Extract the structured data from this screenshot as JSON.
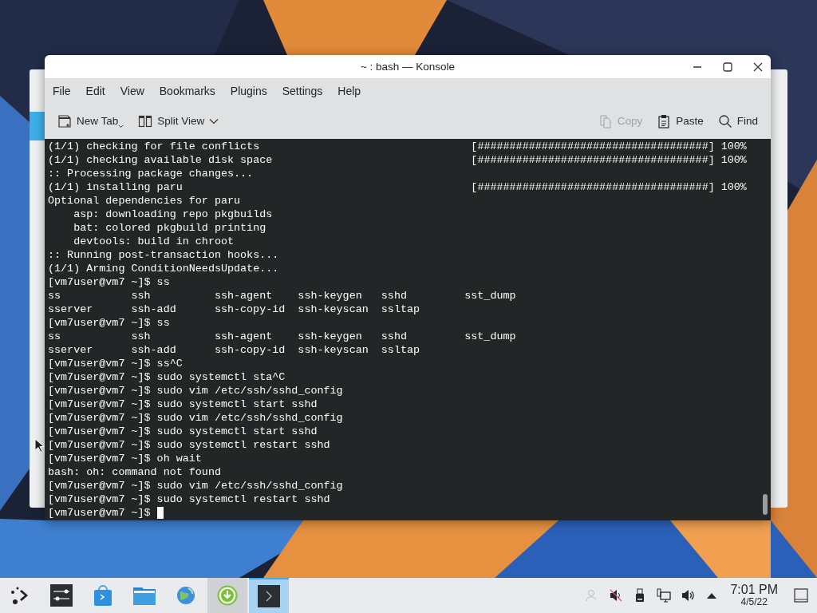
{
  "window": {
    "title": "~ : bash — Konsole"
  },
  "menu": [
    "File",
    "Edit",
    "View",
    "Bookmarks",
    "Plugins",
    "Settings",
    "Help"
  ],
  "toolbar": {
    "left": [
      {
        "kind": "new-tab",
        "label": "New Tab"
      },
      {
        "kind": "split-view",
        "label": "Split View"
      }
    ],
    "right": [
      {
        "kind": "copy",
        "label": "Copy",
        "disabled": true
      },
      {
        "kind": "paste",
        "label": "Paste",
        "disabled": false
      },
      {
        "kind": "find",
        "label": "Find",
        "disabled": false
      }
    ]
  },
  "terminal": {
    "lines": [
      {
        "kind": "text",
        "text": "(1/1) checking for file conflicts",
        "progress": "[####################################] 100%"
      },
      {
        "kind": "text",
        "text": "(1/1) checking available disk space",
        "progress": "[####################################] 100%"
      },
      {
        "kind": "text",
        "text": ":: Processing package changes..."
      },
      {
        "kind": "text",
        "text": "(1/1) installing paru",
        "progress": "[####################################] 100%"
      },
      {
        "kind": "text",
        "text": "Optional dependencies for paru"
      },
      {
        "kind": "text",
        "text": "    asp: downloading repo pkgbuilds"
      },
      {
        "kind": "text",
        "text": "    bat: colored pkgbuild printing"
      },
      {
        "kind": "text",
        "text": "    devtools: build in chroot"
      },
      {
        "kind": "text",
        "text": ":: Running post-transaction hooks..."
      },
      {
        "kind": "text",
        "text": "(1/1) Arming ConditionNeedsUpdate..."
      },
      {
        "kind": "text",
        "text": "[vm7user@vm7 ~]$ ss"
      },
      {
        "kind": "columns",
        "cells": [
          "ss",
          "ssh",
          "ssh-agent",
          "ssh-keygen",
          "sshd",
          "sst_dump"
        ]
      },
      {
        "kind": "columns",
        "cells": [
          "sserver",
          "ssh-add",
          "ssh-copy-id",
          "ssh-keyscan",
          "ssltap"
        ]
      },
      {
        "kind": "text",
        "text": "[vm7user@vm7 ~]$ ss"
      },
      {
        "kind": "columns",
        "cells": [
          "ss",
          "ssh",
          "ssh-agent",
          "ssh-keygen",
          "sshd",
          "sst_dump"
        ]
      },
      {
        "kind": "columns",
        "cells": [
          "sserver",
          "ssh-add",
          "ssh-copy-id",
          "ssh-keyscan",
          "ssltap"
        ]
      },
      {
        "kind": "text",
        "text": "[vm7user@vm7 ~]$ ss^C"
      },
      {
        "kind": "text",
        "text": "[vm7user@vm7 ~]$ sudo systemctl sta^C"
      },
      {
        "kind": "text",
        "text": "[vm7user@vm7 ~]$ sudo vim /etc/ssh/sshd_config"
      },
      {
        "kind": "text",
        "text": "[vm7user@vm7 ~]$ sudo systemctl start sshd"
      },
      {
        "kind": "text",
        "text": "[vm7user@vm7 ~]$ sudo vim /etc/ssh/sshd_config"
      },
      {
        "kind": "text",
        "text": "[vm7user@vm7 ~]$ sudo systemctl start sshd"
      },
      {
        "kind": "text",
        "text": "[vm7user@vm7 ~]$ sudo systemctl restart sshd"
      },
      {
        "kind": "text",
        "text": "[vm7user@vm7 ~]$ oh wait"
      },
      {
        "kind": "text",
        "text": "bash: oh: command not found"
      },
      {
        "kind": "text",
        "text": "[vm7user@vm7 ~]$ sudo vim /etc/ssh/sshd_config"
      },
      {
        "kind": "text",
        "text": "[vm7user@vm7 ~]$ sudo systemctl restart sshd"
      },
      {
        "kind": "text",
        "text": "[vm7user@vm7 ~]$",
        "cursor": true
      }
    ]
  },
  "taskbar": {
    "apps": [
      {
        "kind": "launcher",
        "selected": false,
        "hovered": false
      },
      {
        "kind": "settings",
        "selected": false,
        "hovered": false
      },
      {
        "kind": "store",
        "selected": false,
        "hovered": false
      },
      {
        "kind": "files",
        "selected": false,
        "hovered": false
      },
      {
        "kind": "browser",
        "selected": false,
        "hovered": false
      },
      {
        "kind": "download",
        "selected": false,
        "hovered": true
      },
      {
        "kind": "terminal",
        "selected": true,
        "hovered": false
      }
    ],
    "tray": [
      {
        "kind": "user",
        "disabled": true
      },
      {
        "kind": "muted",
        "disabled": false
      },
      {
        "kind": "usb",
        "disabled": false
      },
      {
        "kind": "network",
        "disabled": false
      },
      {
        "kind": "volume",
        "disabled": false
      },
      {
        "kind": "expand",
        "disabled": false
      }
    ],
    "clock": {
      "time": "7:01 PM",
      "date": "4/5/22"
    }
  }
}
